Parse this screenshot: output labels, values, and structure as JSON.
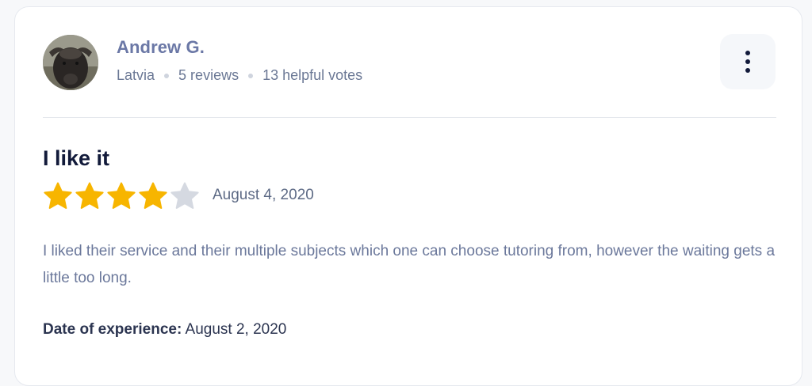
{
  "author": {
    "name": "Andrew G.",
    "country": "Latvia",
    "reviews": "5 reviews",
    "helpful_votes": "13 helpful votes"
  },
  "menu": {
    "icon": "more-vertical-icon"
  },
  "review": {
    "title": "I like it",
    "rating": 4,
    "max_rating": 5,
    "date": "August 4, 2020",
    "body": "I liked their service and their multiple subjects which one can choose tutoring from, however the waiting gets a little too long.",
    "experience_label": "Date of experience:",
    "experience_date": "August 2, 2020"
  },
  "colors": {
    "star_filled": "#f7b500",
    "star_empty": "#d5d9e1",
    "author_name": "#6b78a6"
  }
}
